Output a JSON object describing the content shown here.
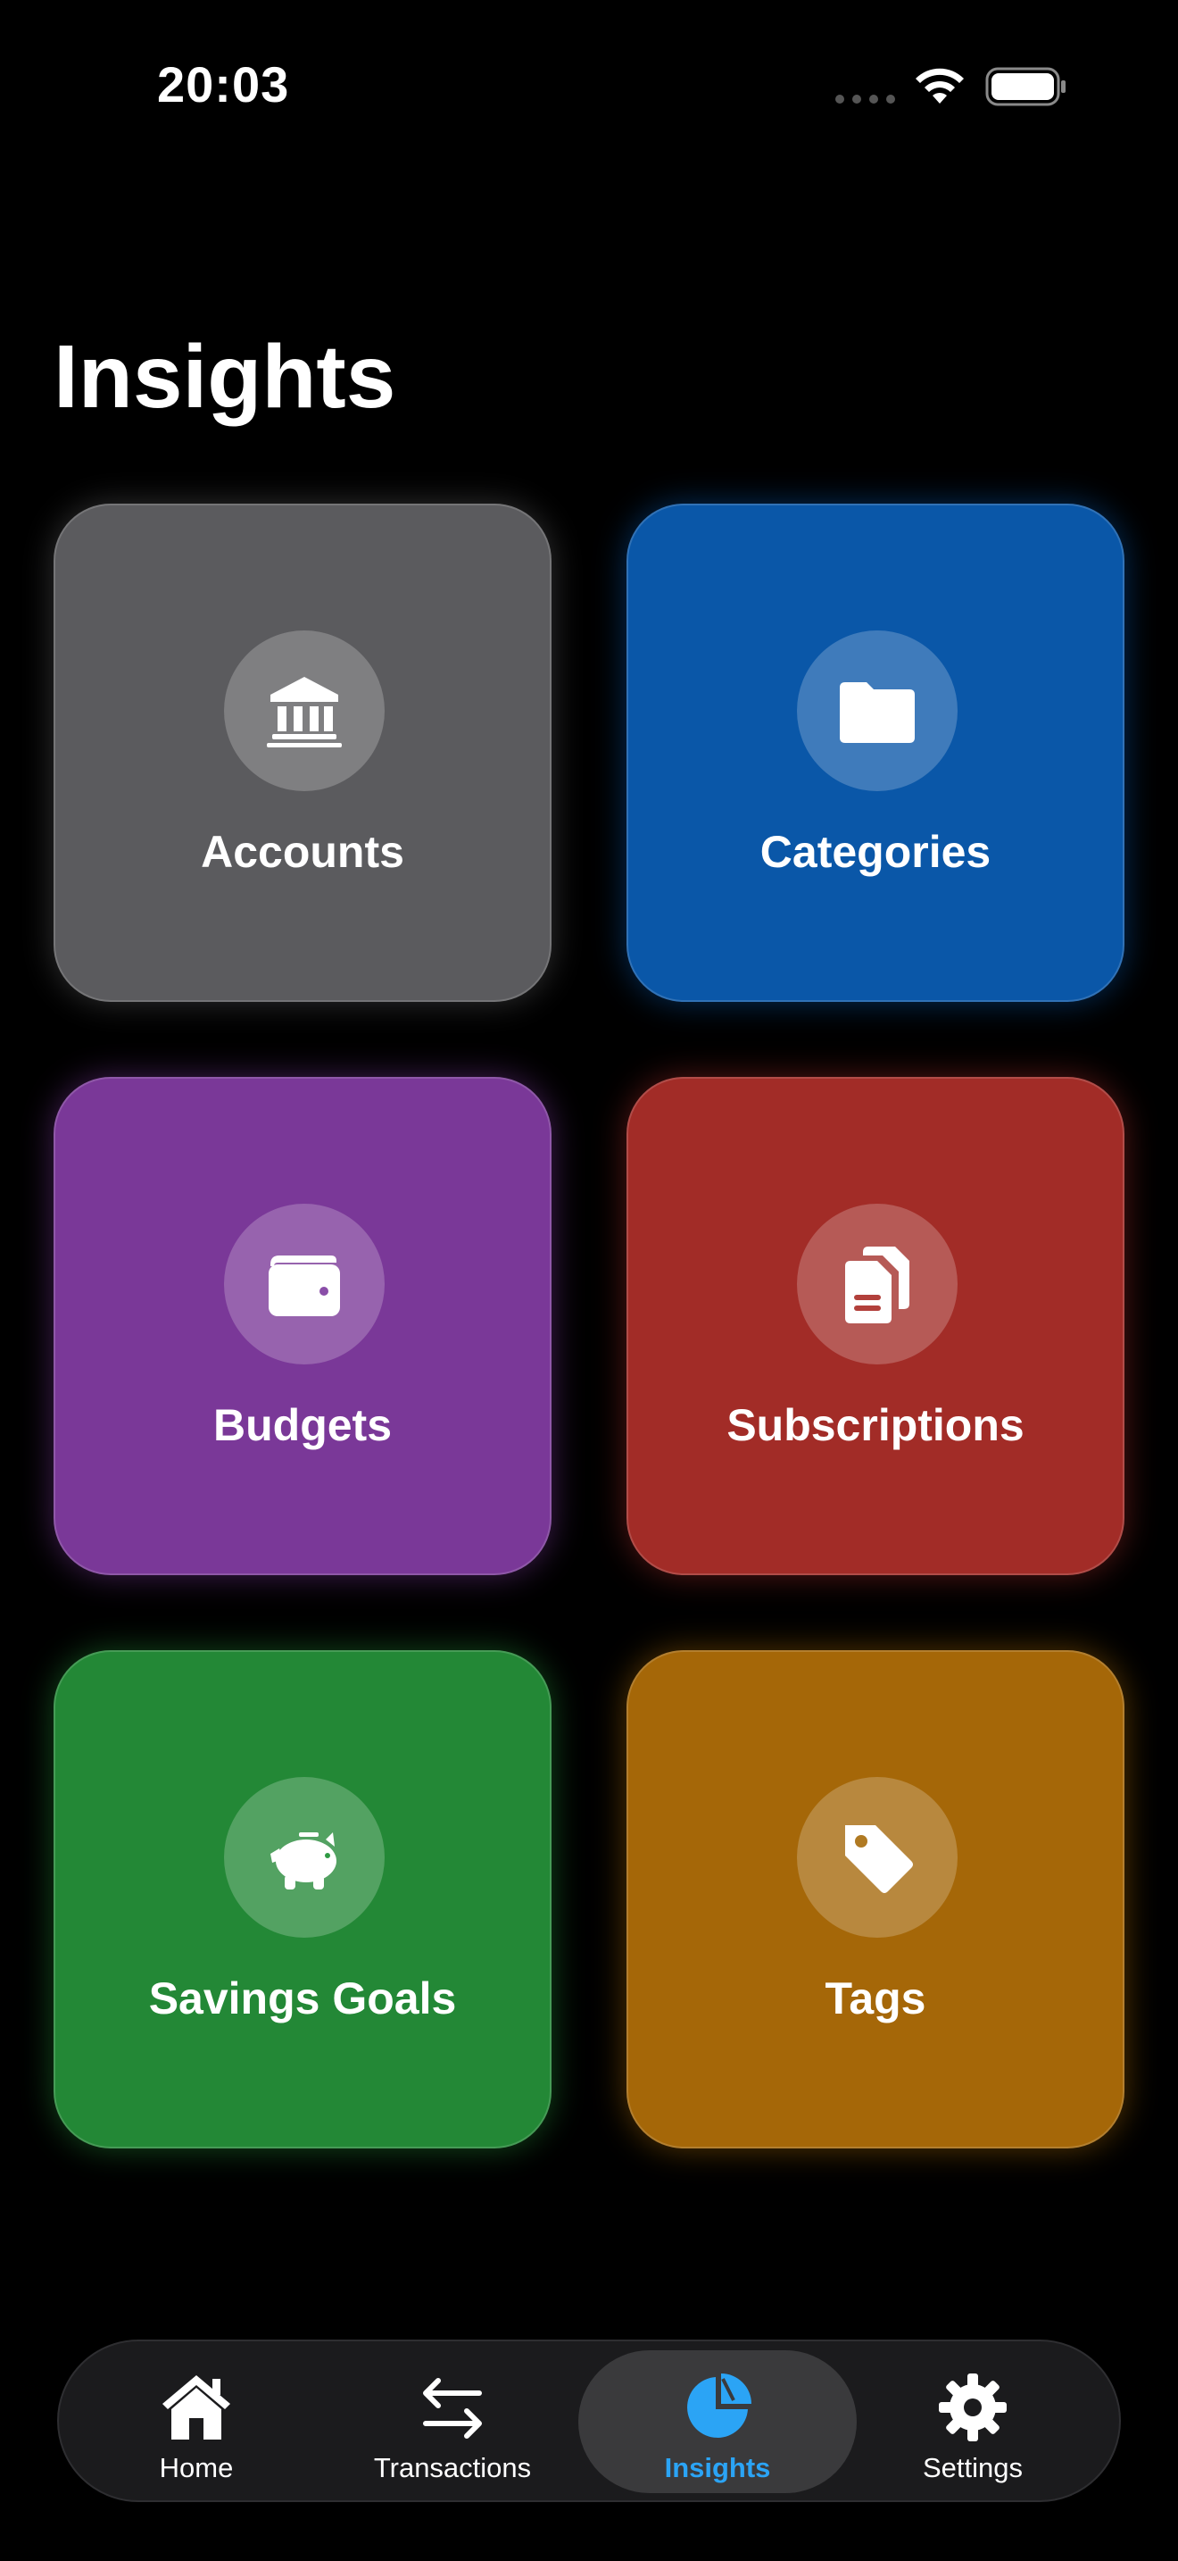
{
  "status_bar": {
    "time": "20:03",
    "signal_icon": "signal-dots-icon",
    "wifi_icon": "wifi-icon",
    "battery_icon": "battery-icon"
  },
  "page": {
    "title": "Insights"
  },
  "tiles": [
    {
      "label": "Accounts",
      "icon": "bank-icon",
      "color": "#5b5b5e"
    },
    {
      "label": "Categories",
      "icon": "folder-icon",
      "color": "#0a57a8"
    },
    {
      "label": "Budgets",
      "icon": "wallet-icon",
      "color": "#7a3898"
    },
    {
      "label": "Subscriptions",
      "icon": "documents-icon",
      "color": "#a22c27"
    },
    {
      "label": "Savings Goals",
      "icon": "piggy-bank-icon",
      "color": "#238836"
    },
    {
      "label": "Tags",
      "icon": "tag-icon",
      "color": "#a56708"
    }
  ],
  "tab_bar": {
    "active_color": "#2ba4f5",
    "tabs": [
      {
        "label": "Home",
        "icon": "house-icon",
        "active": false
      },
      {
        "label": "Transactions",
        "icon": "arrows-swap-icon",
        "active": false
      },
      {
        "label": "Insights",
        "icon": "pie-chart-icon",
        "active": true
      },
      {
        "label": "Settings",
        "icon": "gear-icon",
        "active": false
      }
    ]
  }
}
